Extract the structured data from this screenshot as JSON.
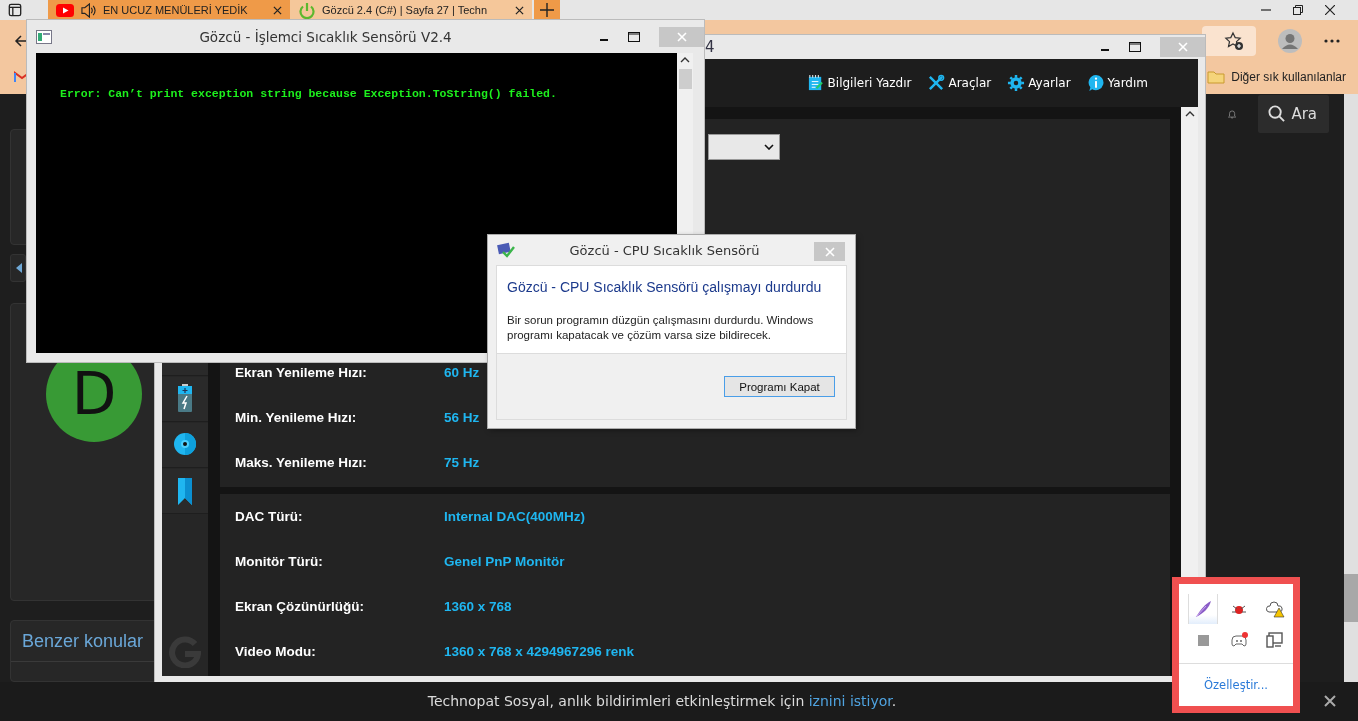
{
  "browser": {
    "tabs": [
      {
        "title": "EN UCUZ MENÜLERİ YEDİK",
        "selected": false
      },
      {
        "title": "Gözcü 2.4 (C#) | Sayfa 27 | Techn",
        "selected": true
      }
    ],
    "bookmarks": [
      {
        "label": "Diğer sık kullanılanlar"
      }
    ],
    "page": {
      "search_label": "Ara",
      "avatar_letter": "D",
      "similar_heading": "Benzer konular"
    },
    "notification": {
      "text": "Technopat Sosyal, anlık bildirimleri etkinleştirmek için ",
      "link": "iznini istiyor",
      "end": "."
    }
  },
  "app_window": {
    "title": "4",
    "menu": [
      {
        "label": "Bilgileri Yazdır"
      },
      {
        "label": "Araçlar"
      },
      {
        "label": "Ayarlar"
      },
      {
        "label": "Yardım"
      }
    ],
    "groups": [
      {
        "rows": [
          {
            "label": "Ekran Yenileme Hızı:",
            "value": "60 Hz"
          },
          {
            "label": "Min. Yenileme Hızı:",
            "value": "56 Hz"
          },
          {
            "label": "Maks. Yenileme Hızı:",
            "value": "75 Hz"
          }
        ]
      },
      {
        "rows": [
          {
            "label": "DAC Türü:",
            "value": "Internal DAC(400MHz)"
          },
          {
            "label": "Monitör Türü:",
            "value": "Genel PnP Monitör"
          },
          {
            "label": "Ekran Çözünürlüğü:",
            "value": "1360 x 768"
          },
          {
            "label": "Video Modu:",
            "value": "1360 x 768 x 4294967296 renk"
          }
        ]
      }
    ]
  },
  "console_window": {
    "title": "Gözcü - İşlemci Sıcaklık Sensörü V2.4",
    "output": "Error: Can’t print exception string because Exception.ToString() failed."
  },
  "error_dialog": {
    "title": "Gözcü - CPU Sıcaklık Sensörü",
    "heading": "Gözcü - CPU Sıcaklık Sensörü çalışmayı durdurdu",
    "message": "Bir sorun programın düzgün çalışmasını durdurdu. Windows programı kapatacak ve çözüm varsa size bildirecek.",
    "button": "Programı Kapat"
  },
  "tray_popup": {
    "customize_link": "Özelleştir..."
  }
}
